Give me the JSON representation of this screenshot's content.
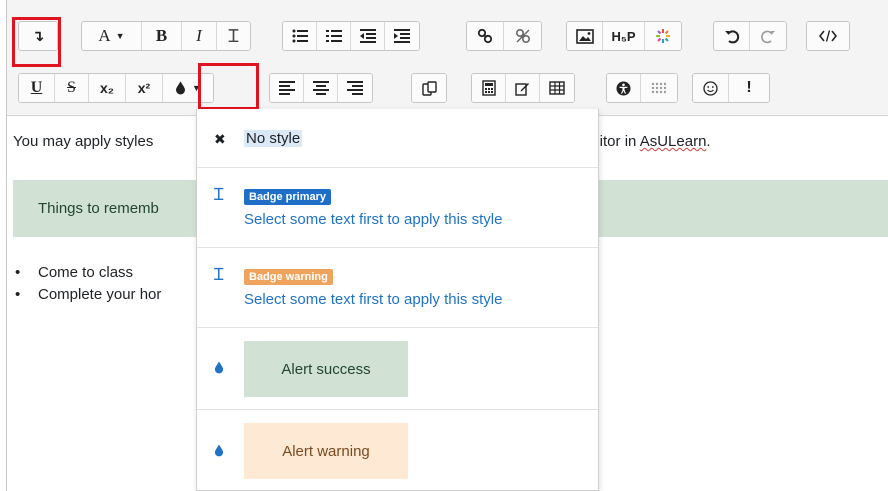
{
  "toolbar": {
    "row1": {
      "show_more": "↴",
      "font_size": "A",
      "bold": "B",
      "italic": "I",
      "clear_format": "Ɪ",
      "h5p": "H₅P"
    },
    "row2": {
      "underline": "U",
      "strike": "S",
      "subscript": "x₂",
      "superscript": "x²",
      "warning": "!"
    }
  },
  "content": {
    "intro_text": "You may apply styles",
    "intro_tail_prefix": "editor in ",
    "intro_tail_word": "AsULearn",
    "intro_tail_suffix": ".",
    "alert_text": "Things to rememb",
    "list_items": [
      "Come to class",
      "Complete your hor"
    ]
  },
  "styles_menu": {
    "no_style": "No style",
    "badge_primary": "Badge primary",
    "badge_warning": "Badge warning",
    "hint": "Select some text first to apply this style",
    "alert_success": "Alert success",
    "alert_warning": "Alert warning"
  },
  "colors": {
    "highlight": "#e0141e",
    "badge_primary": "#1f6fc8",
    "badge_warning": "#f0a35c",
    "alert_success_bg": "#d1e2d5",
    "alert_warning_bg": "#fde9d4",
    "link_blue": "#1f72c4"
  }
}
